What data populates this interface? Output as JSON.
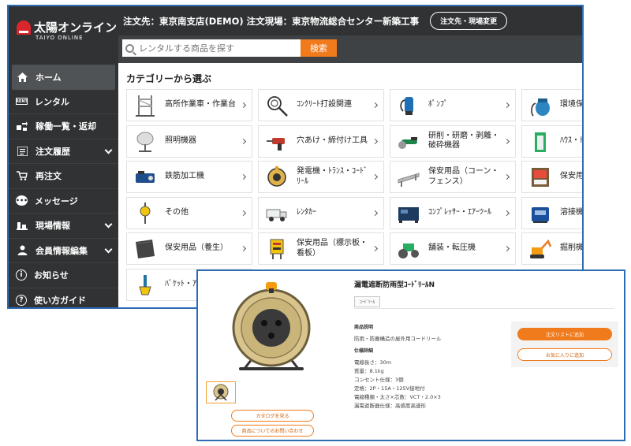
{
  "brand": {
    "name": "太陽オンライン",
    "sub": "TAIYO ONLINE"
  },
  "topbar": {
    "order_info": "注文先：東京南支店(DEMO) 注文現場：東京物流総合センター新築工事",
    "change_label": "注文先・現場変更"
  },
  "search": {
    "placeholder": "レンタルする商品を探す",
    "button": "検索"
  },
  "sidebar": {
    "items": [
      {
        "label": "ホーム",
        "icon": "home-icon",
        "chevron": false
      },
      {
        "label": "レンタル",
        "icon": "rent-icon",
        "chevron": false
      },
      {
        "label": "稼働一覧・返却",
        "icon": "return-icon",
        "chevron": false
      },
      {
        "label": "注文履歴",
        "icon": "list-icon",
        "chevron": true
      },
      {
        "label": "再注文",
        "icon": "reorder-icon",
        "chevron": false
      },
      {
        "label": "メッセージ",
        "icon": "message-icon",
        "chevron": false
      },
      {
        "label": "現場情報",
        "icon": "site-icon",
        "chevron": true
      },
      {
        "label": "会員情報編集",
        "icon": "user-icon",
        "chevron": true
      },
      {
        "label": "お知らせ",
        "icon": "info-icon",
        "chevron": false
      },
      {
        "label": "使い方ガイド",
        "icon": "help-icon",
        "chevron": false
      }
    ],
    "icon_glyphs": {
      "rent": "RENT",
      "info": "i",
      "help": "?",
      "message": "•••"
    }
  },
  "categories": {
    "title": "カテゴリーから選ぶ",
    "items": [
      {
        "label": "高所作業車・作業台",
        "icon": "scaffold-icon"
      },
      {
        "label": "ｺﾝｸﾘｰﾄ打設関連",
        "icon": "vibrator-icon"
      },
      {
        "label": "ﾎﾟﾝﾌﾟ",
        "icon": "pump-icon"
      },
      {
        "label": "環境保護機器",
        "icon": "vacuum-icon"
      },
      {
        "label": "照明機器",
        "icon": "light-icon"
      },
      {
        "label": "穴あけ・締付け工具",
        "icon": "drill-icon"
      },
      {
        "label": "研削・研磨・剥離・破砕機器",
        "icon": "grinder-icon"
      },
      {
        "label": "ﾊｳｽ・ﾄｲﾚ",
        "icon": "house-icon"
      },
      {
        "label": "鉄筋加工機",
        "icon": "rebar-icon"
      },
      {
        "label": "発電機・ﾄﾗﾝｽ・ｺｰﾄﾞﾘｰﾙ",
        "icon": "cord-reel-icon"
      },
      {
        "label": "保安用品（コーン・フェンス）",
        "icon": "fence-icon"
      },
      {
        "label": "保安用品・器・他",
        "icon": "panel-icon"
      },
      {
        "label": "その他",
        "icon": "hoist-icon"
      },
      {
        "label": "ﾚﾝﾀｶｰ",
        "icon": "truck-icon"
      },
      {
        "label": "ｺﾝﾌﾟﾚｯｻｰ・ｴｱｰﾂｰﾙ",
        "icon": "compressor-icon"
      },
      {
        "label": "溶接機",
        "icon": "welder-icon"
      },
      {
        "label": "保安用品（養生）",
        "icon": "sheet-icon"
      },
      {
        "label": "保安用品（標示板・看板）",
        "icon": "sign-icon"
      },
      {
        "label": "舗装・転圧機",
        "icon": "roller-icon"
      },
      {
        "label": "掘削機",
        "icon": "excavator-icon"
      },
      {
        "label": "ﾊﾞｹｯﾄ・ｱﾀｯﾁﾒﾝﾄ",
        "icon": "bucket-icon"
      }
    ]
  },
  "product": {
    "title": "漏電遮断防雨型ｺｰﾄﾞﾘｰﾙN",
    "tag": "ｺｰﾄﾞﾘｰﾙ",
    "desc_label": "商品説明",
    "desc": "防雨・防塵構造の屋外用コードリール",
    "spec_label": "仕様詳細",
    "specs": [
      "電線長さ：30m",
      "質量：8.1kg",
      "コンセント仕様：3個",
      "定格：2P・15A・125V接地付",
      "電線種類・太さ×芯数：VCT・2.0×3",
      "漏電遮断器仕様：高感度高速形"
    ],
    "catalog_label": "カタログを見る",
    "inquiry_label": "商品についてのお問い合わせ",
    "cart_label": "注文リストに追加",
    "fav_label": "お気に入りに追加"
  },
  "colors": {
    "accent": "#f07b1c",
    "sidebar": "#303234",
    "frame": "#2e6db4"
  }
}
